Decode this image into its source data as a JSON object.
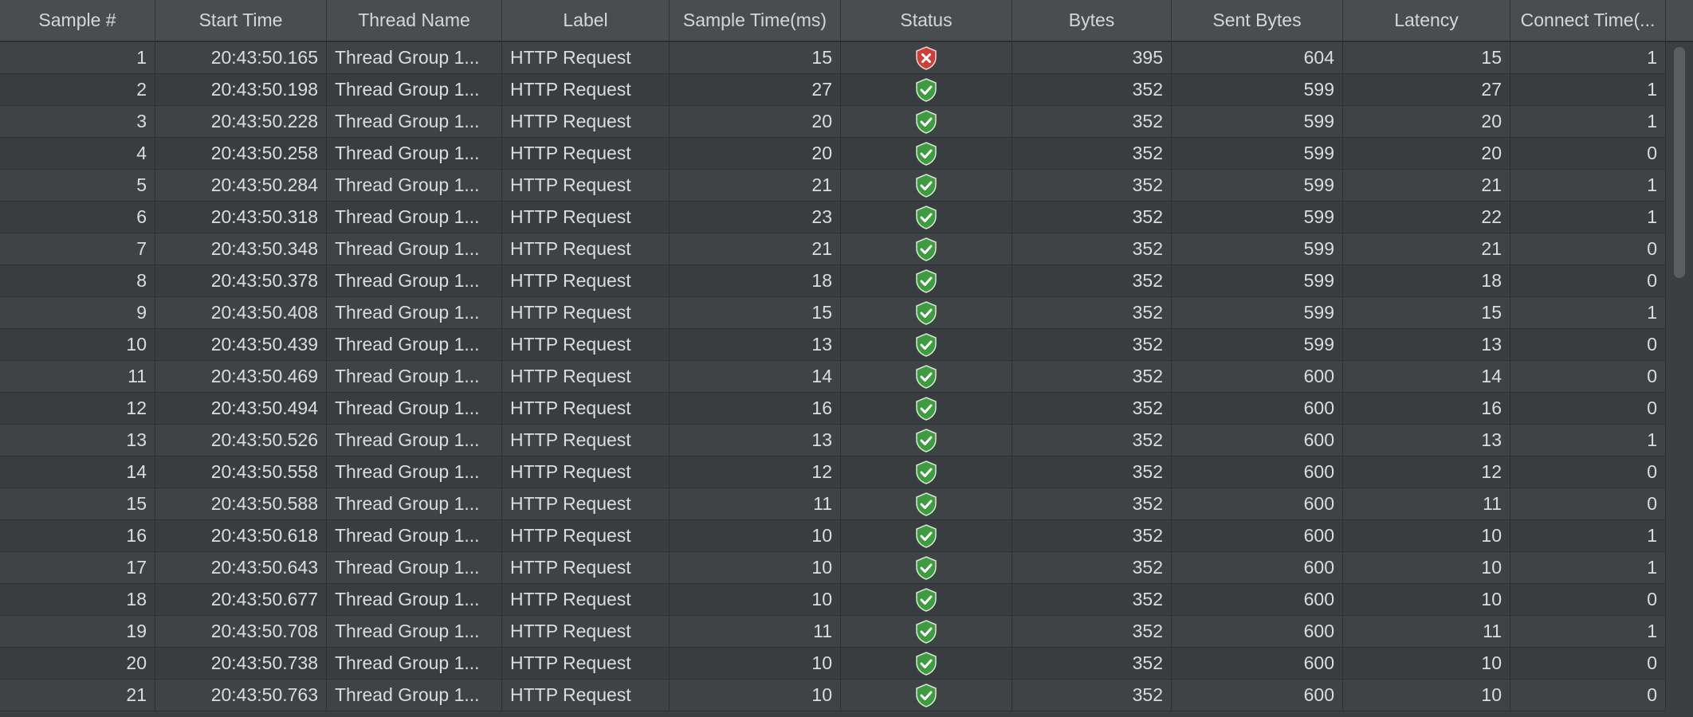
{
  "table": {
    "columns": [
      "Sample #",
      "Start Time",
      "Thread Name",
      "Label",
      "Sample Time(ms)",
      "Status",
      "Bytes",
      "Sent Bytes",
      "Latency",
      "Connect Time(..."
    ],
    "rows": [
      {
        "sample": "1",
        "start_time": "20:43:50.165",
        "thread": "Thread Group 1...",
        "label": "HTTP Request",
        "sample_time": "15",
        "status": "error",
        "bytes": "395",
        "sent_bytes": "604",
        "latency": "15",
        "connect_time": "1"
      },
      {
        "sample": "2",
        "start_time": "20:43:50.198",
        "thread": "Thread Group 1...",
        "label": "HTTP Request",
        "sample_time": "27",
        "status": "success",
        "bytes": "352",
        "sent_bytes": "599",
        "latency": "27",
        "connect_time": "1"
      },
      {
        "sample": "3",
        "start_time": "20:43:50.228",
        "thread": "Thread Group 1...",
        "label": "HTTP Request",
        "sample_time": "20",
        "status": "success",
        "bytes": "352",
        "sent_bytes": "599",
        "latency": "20",
        "connect_time": "1"
      },
      {
        "sample": "4",
        "start_time": "20:43:50.258",
        "thread": "Thread Group 1...",
        "label": "HTTP Request",
        "sample_time": "20",
        "status": "success",
        "bytes": "352",
        "sent_bytes": "599",
        "latency": "20",
        "connect_time": "0"
      },
      {
        "sample": "5",
        "start_time": "20:43:50.284",
        "thread": "Thread Group 1...",
        "label": "HTTP Request",
        "sample_time": "21",
        "status": "success",
        "bytes": "352",
        "sent_bytes": "599",
        "latency": "21",
        "connect_time": "1"
      },
      {
        "sample": "6",
        "start_time": "20:43:50.318",
        "thread": "Thread Group 1...",
        "label": "HTTP Request",
        "sample_time": "23",
        "status": "success",
        "bytes": "352",
        "sent_bytes": "599",
        "latency": "22",
        "connect_time": "1"
      },
      {
        "sample": "7",
        "start_time": "20:43:50.348",
        "thread": "Thread Group 1...",
        "label": "HTTP Request",
        "sample_time": "21",
        "status": "success",
        "bytes": "352",
        "sent_bytes": "599",
        "latency": "21",
        "connect_time": "0"
      },
      {
        "sample": "8",
        "start_time": "20:43:50.378",
        "thread": "Thread Group 1...",
        "label": "HTTP Request",
        "sample_time": "18",
        "status": "success",
        "bytes": "352",
        "sent_bytes": "599",
        "latency": "18",
        "connect_time": "0"
      },
      {
        "sample": "9",
        "start_time": "20:43:50.408",
        "thread": "Thread Group 1...",
        "label": "HTTP Request",
        "sample_time": "15",
        "status": "success",
        "bytes": "352",
        "sent_bytes": "599",
        "latency": "15",
        "connect_time": "1"
      },
      {
        "sample": "10",
        "start_time": "20:43:50.439",
        "thread": "Thread Group 1...",
        "label": "HTTP Request",
        "sample_time": "13",
        "status": "success",
        "bytes": "352",
        "sent_bytes": "599",
        "latency": "13",
        "connect_time": "0"
      },
      {
        "sample": "11",
        "start_time": "20:43:50.469",
        "thread": "Thread Group 1...",
        "label": "HTTP Request",
        "sample_time": "14",
        "status": "success",
        "bytes": "352",
        "sent_bytes": "600",
        "latency": "14",
        "connect_time": "0"
      },
      {
        "sample": "12",
        "start_time": "20:43:50.494",
        "thread": "Thread Group 1...",
        "label": "HTTP Request",
        "sample_time": "16",
        "status": "success",
        "bytes": "352",
        "sent_bytes": "600",
        "latency": "16",
        "connect_time": "0"
      },
      {
        "sample": "13",
        "start_time": "20:43:50.526",
        "thread": "Thread Group 1...",
        "label": "HTTP Request",
        "sample_time": "13",
        "status": "success",
        "bytes": "352",
        "sent_bytes": "600",
        "latency": "13",
        "connect_time": "1"
      },
      {
        "sample": "14",
        "start_time": "20:43:50.558",
        "thread": "Thread Group 1...",
        "label": "HTTP Request",
        "sample_time": "12",
        "status": "success",
        "bytes": "352",
        "sent_bytes": "600",
        "latency": "12",
        "connect_time": "0"
      },
      {
        "sample": "15",
        "start_time": "20:43:50.588",
        "thread": "Thread Group 1...",
        "label": "HTTP Request",
        "sample_time": "11",
        "status": "success",
        "bytes": "352",
        "sent_bytes": "600",
        "latency": "11",
        "connect_time": "0"
      },
      {
        "sample": "16",
        "start_time": "20:43:50.618",
        "thread": "Thread Group 1...",
        "label": "HTTP Request",
        "sample_time": "10",
        "status": "success",
        "bytes": "352",
        "sent_bytes": "600",
        "latency": "10",
        "connect_time": "1"
      },
      {
        "sample": "17",
        "start_time": "20:43:50.643",
        "thread": "Thread Group 1...",
        "label": "HTTP Request",
        "sample_time": "10",
        "status": "success",
        "bytes": "352",
        "sent_bytes": "600",
        "latency": "10",
        "connect_time": "1"
      },
      {
        "sample": "18",
        "start_time": "20:43:50.677",
        "thread": "Thread Group 1...",
        "label": "HTTP Request",
        "sample_time": "10",
        "status": "success",
        "bytes": "352",
        "sent_bytes": "600",
        "latency": "10",
        "connect_time": "0"
      },
      {
        "sample": "19",
        "start_time": "20:43:50.708",
        "thread": "Thread Group 1...",
        "label": "HTTP Request",
        "sample_time": "11",
        "status": "success",
        "bytes": "352",
        "sent_bytes": "600",
        "latency": "11",
        "connect_time": "1"
      },
      {
        "sample": "20",
        "start_time": "20:43:50.738",
        "thread": "Thread Group 1...",
        "label": "HTTP Request",
        "sample_time": "10",
        "status": "success",
        "bytes": "352",
        "sent_bytes": "600",
        "latency": "10",
        "connect_time": "0"
      },
      {
        "sample": "21",
        "start_time": "20:43:50.763",
        "thread": "Thread Group 1...",
        "label": "HTTP Request",
        "sample_time": "10",
        "status": "success",
        "bytes": "352",
        "sent_bytes": "600",
        "latency": "10",
        "connect_time": "0"
      }
    ]
  },
  "icons": {
    "success": "green-shield-check-icon",
    "error": "red-shield-x-icon"
  },
  "colors": {
    "background": "#3c3f41",
    "header": "#4a4d50",
    "text": "#dcdcdc",
    "success": "#4caf50",
    "error": "#d9463e"
  }
}
